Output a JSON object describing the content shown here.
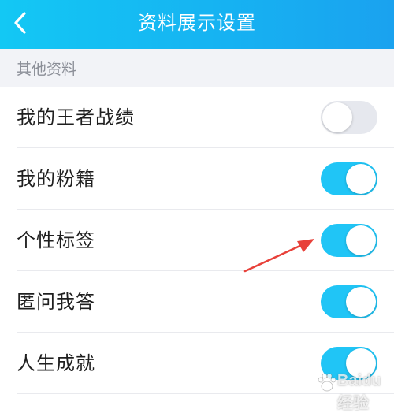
{
  "header": {
    "title": "资料展示设置",
    "back_icon": "chevron-left-icon",
    "gradient": [
      "#13c8f4",
      "#1aa2ef"
    ]
  },
  "section": {
    "label": "其他资料"
  },
  "items": [
    {
      "label": "我的王者战绩",
      "enabled": false
    },
    {
      "label": "我的粉籍",
      "enabled": true
    },
    {
      "label": "个性标签",
      "enabled": true
    },
    {
      "label": "匿问我答",
      "enabled": true
    },
    {
      "label": "人生成就",
      "enabled": true
    }
  ],
  "colors": {
    "toggle_on": "#20c5f6",
    "toggle_off": "#e6e8ee",
    "annotation_arrow": "#e8413a"
  },
  "watermark": {
    "text": "Baidu 经验",
    "icon": "paw-icon"
  }
}
